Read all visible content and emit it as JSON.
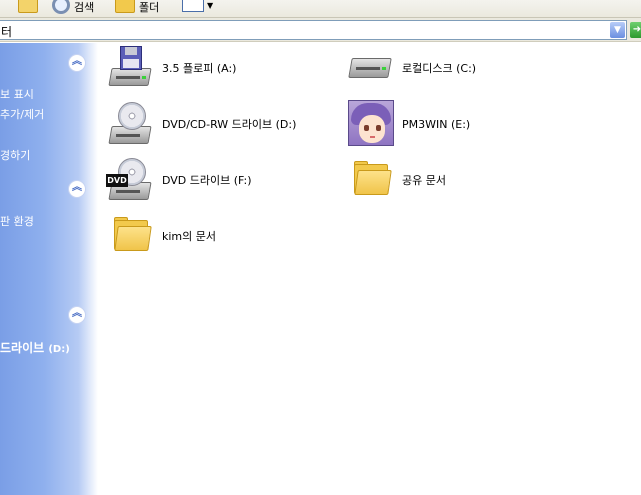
{
  "toolbar": {
    "search_label": "검색",
    "folders_label": "폴더"
  },
  "address": {
    "value": "터"
  },
  "taskpane": {
    "system_tasks": [
      "보 표시",
      "추가/제거",
      "경하기"
    ],
    "other_places": [
      "판 환경"
    ],
    "details_title": "드라이브",
    "details_sub": "(D:)"
  },
  "items": [
    {
      "name": "3.5 플로피 (A:)",
      "icon": "floppy-drive-icon"
    },
    {
      "name": "로컬디스크 (C:)",
      "icon": "hard-disk-icon"
    },
    {
      "name": "DVD/CD-RW 드라이브 (D:)",
      "icon": "cd-drive-icon"
    },
    {
      "name": "PM3WIN (E:)",
      "icon": "custom-avatar-drive-icon"
    },
    {
      "name": "DVD 드라이브 (F:)",
      "icon": "dvd-drive-icon"
    },
    {
      "name": "공유 문서",
      "icon": "folder-icon"
    },
    {
      "name": "kim의 문서",
      "icon": "folder-icon"
    }
  ],
  "colors": {
    "pane_blue": "#7a9ee6",
    "folder_yellow": "#f2c94c",
    "dvd_tag": "#111111"
  },
  "icons": {
    "collapse": "chevron-up-icon",
    "dropdown": "chevron-down-icon",
    "go": "go-arrow-icon"
  }
}
